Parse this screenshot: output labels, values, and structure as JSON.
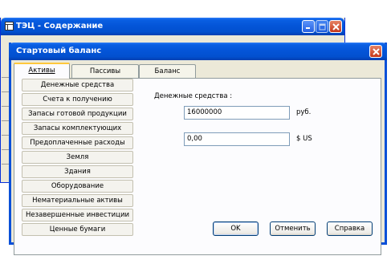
{
  "main_window": {
    "title": "ТЭЦ - Содержание",
    "buttons": {
      "minimize": "minimize-icon",
      "maximize": "maximize-icon",
      "close": "close-icon"
    }
  },
  "dialog": {
    "title": "Стартовый баланс",
    "close_icon": "close-icon",
    "tabs": [
      {
        "label": "Активы",
        "active": true
      },
      {
        "label": "Пассивы",
        "active": false
      },
      {
        "label": "Баланс",
        "active": false
      }
    ],
    "asset_items": [
      "Денежные средства",
      "Счета к получению",
      "Запасы готовой продукции",
      "Запасы комплектующих",
      "Предоплаченные расходы",
      "Земля",
      "Здания",
      "Оборудование",
      "Нематериальные активы",
      "Незавершенные инвестиции",
      "Ценные бумаги"
    ],
    "detail": {
      "section_label": "Денежные средства :",
      "rub_value": "16000000",
      "rub_unit": "руб.",
      "usd_value": "0,00",
      "usd_unit": "$ US"
    },
    "buttons": {
      "ok": "OK",
      "cancel": "Отменить",
      "help": "Справка"
    }
  },
  "colors": {
    "titlebar": "#0455d8",
    "window_face": "#ece9d8",
    "close_button": "#c4371a"
  }
}
